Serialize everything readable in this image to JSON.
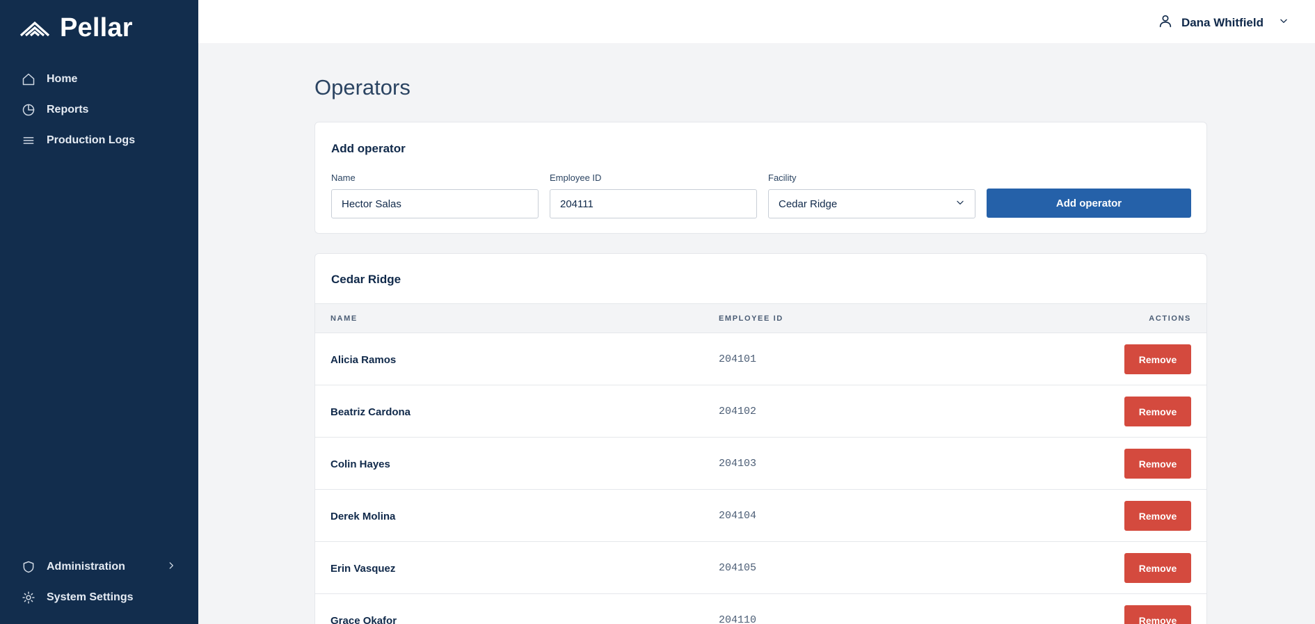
{
  "app": {
    "brand_name": "Pellar",
    "logo_icon": "mountain-chevrons-logo"
  },
  "sidebar": {
    "items": [
      {
        "label": "Home",
        "icon": "home-icon"
      },
      {
        "label": "Reports",
        "icon": "pie-chart-icon"
      },
      {
        "label": "Production Logs",
        "icon": "list-icon"
      }
    ],
    "bottom_items": [
      {
        "label": "Administration",
        "icon": "shield-icon",
        "has_submenu": true
      },
      {
        "label": "System Settings",
        "icon": "sun-settings-icon"
      }
    ]
  },
  "topbar": {
    "user_name": "Dana Whitfield",
    "user_icon": "user-icon"
  },
  "page": {
    "title": "Operators"
  },
  "add_form": {
    "title": "Add operator",
    "name_label": "Name",
    "name_value": "Hector Salas",
    "employee_id_label": "Employee ID",
    "employee_id_value": "204111",
    "facility_label": "Facility",
    "facility_value": "Cedar Ridge",
    "submit_label": "Add operator"
  },
  "table": {
    "title": "Cedar Ridge",
    "columns": {
      "name": "NAME",
      "employee_id": "EMPLOYEE ID",
      "actions": "ACTIONS"
    },
    "action_label": "Remove",
    "rows": [
      {
        "name": "Alicia Ramos",
        "employee_id": "204101"
      },
      {
        "name": "Beatriz Cardona",
        "employee_id": "204102"
      },
      {
        "name": "Colin Hayes",
        "employee_id": "204103"
      },
      {
        "name": "Derek Molina",
        "employee_id": "204104"
      },
      {
        "name": "Erin Vasquez",
        "employee_id": "204105"
      },
      {
        "name": "Grace Okafor",
        "employee_id": "204110"
      }
    ]
  },
  "colors": {
    "sidebar_bg": "#122d4d",
    "primary_button": "#2561a9",
    "danger_button": "#d44a3e",
    "page_bg": "#f3f4f6"
  }
}
